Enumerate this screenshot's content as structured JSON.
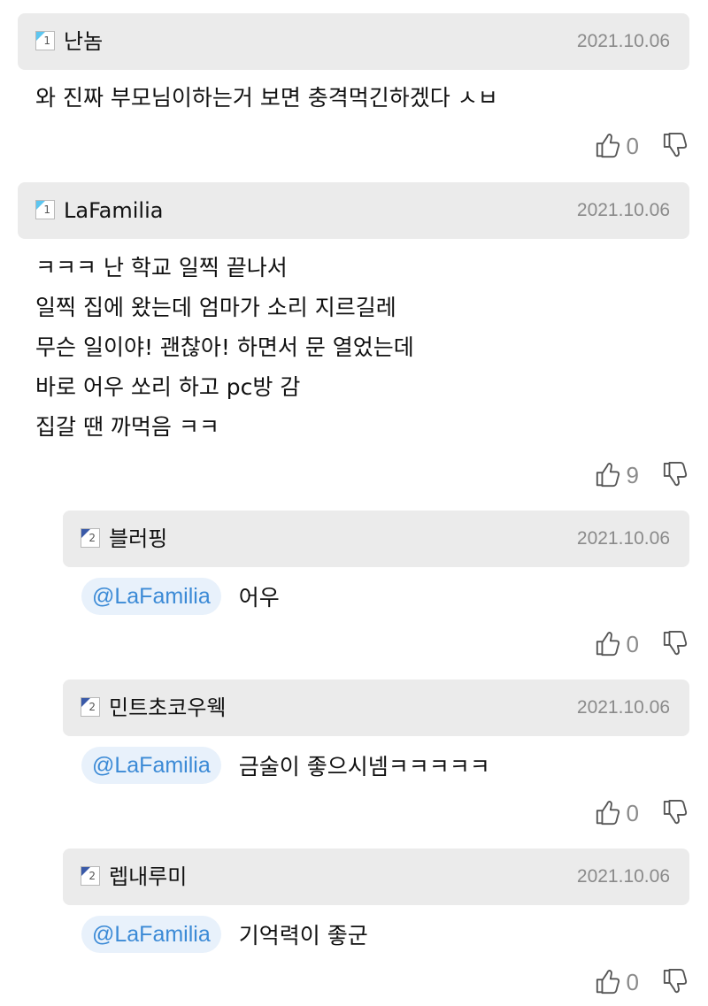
{
  "comments": [
    {
      "nickname": "난놈",
      "level": "1",
      "date": "2021.10.06",
      "text": "와 진짜 부모님이하는거 보면 충격먹긴하겠다 ㅅㅂ",
      "likes": "0"
    },
    {
      "nickname": "LaFamilia",
      "level": "1",
      "date": "2021.10.06",
      "text": "ㅋㅋㅋ 난 학교 일찍 끝나서\n일찍 집에 왔는데 엄마가 소리 지르길레\n무슨 일이야! 괜찮아! 하면서 문 열었는데\n바로 어우 쏘리 하고 pc방 감\n집갈 땐 까먹음 ㅋㅋ",
      "likes": "9"
    }
  ],
  "replies": [
    {
      "nickname": "블러핑",
      "level": "2",
      "date": "2021.10.06",
      "mention": "@LaFamilia",
      "text": "어우",
      "likes": "0"
    },
    {
      "nickname": "민트초코우웩",
      "level": "2",
      "date": "2021.10.06",
      "mention": "@LaFamilia",
      "text": "금술이 좋으시넴ㅋㅋㅋㅋㅋ",
      "likes": "0"
    },
    {
      "nickname": "렙내루미",
      "level": "2",
      "date": "2021.10.06",
      "mention": "@LaFamilia",
      "text": "기억력이 좋군",
      "likes": "0"
    }
  ],
  "icons": {
    "like": "thumbs-up-icon",
    "dislike": "thumbs-down-icon",
    "level1_color": "#5cc6f0",
    "level2_color": "#3a5aa8"
  }
}
